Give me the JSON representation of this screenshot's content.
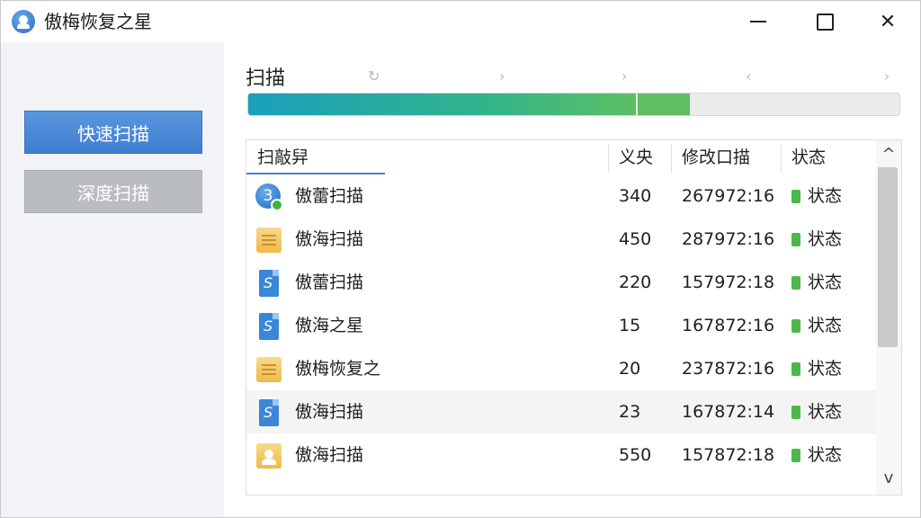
{
  "app": {
    "title": "傲梅恢复之星",
    "icon": "person-circle-icon"
  },
  "window_controls": {
    "minimize": "minimize-icon",
    "maximize": "maximize-icon",
    "close": "close-icon",
    "close_glyph": "✕"
  },
  "sidebar": {
    "quick_scan_label": "快速扫描",
    "deep_scan_label": "深度扫描"
  },
  "scan": {
    "title": "扫描",
    "steps": [
      "↻",
      "›",
      "›",
      "‹",
      "›"
    ],
    "progress_fraction": 0.595,
    "progress_segment_fraction": 0.08
  },
  "table": {
    "columns": [
      "扫敲舁",
      "义央",
      "修改口描",
      "状态"
    ],
    "rows": [
      {
        "icon": "circle-3",
        "name": "傲蕾扫描",
        "size": "340",
        "date": "267972:16",
        "status": "状态"
      },
      {
        "icon": "folder",
        "name": "傲海扫描",
        "size": "450",
        "date": "287972:16",
        "status": "状态"
      },
      {
        "icon": "doc",
        "name": "傲蕾扫描",
        "size": "220",
        "date": "157972:18",
        "status": "状态"
      },
      {
        "icon": "doc",
        "name": "傲海之星",
        "size": "15",
        "date": "167872:16",
        "status": "状态"
      },
      {
        "icon": "folder",
        "name": "傲梅恢复之",
        "size": "20",
        "date": "237872:16",
        "status": "状态"
      },
      {
        "icon": "doc",
        "name": "傲海扫描",
        "size": "23",
        "date": "167872:14",
        "status": "状态"
      },
      {
        "icon": "folder-person",
        "name": "傲海扫描",
        "size": "550",
        "date": "157872:18",
        "status": "状态"
      }
    ],
    "icon_glyph_circle": "3",
    "icon_glyph_doc": "S",
    "scroll_up": "^",
    "scroll_down": "v"
  },
  "colors": {
    "accent": "#4a7fd0",
    "progress_start": "#1aa0bd",
    "progress_end": "#5cc064",
    "status_green": "#4cb84a"
  }
}
